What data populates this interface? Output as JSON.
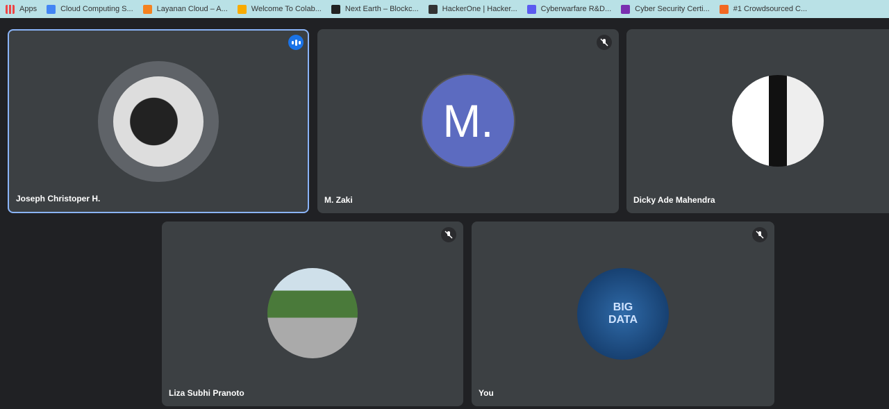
{
  "bookmarks": [
    {
      "label": "Apps",
      "icon": "apps-grid-icon",
      "color": "#e44"
    },
    {
      "label": "Cloud Computing S...",
      "icon": "google-cloud-icon",
      "color": "#4285f4"
    },
    {
      "label": "Layanan Cloud – A...",
      "icon": "aws-cube-icon",
      "color": "#f5821f"
    },
    {
      "label": "Welcome To Colab...",
      "icon": "colab-icon",
      "color": "#f9ab00"
    },
    {
      "label": "Next Earth – Blockc...",
      "icon": "next-earth-icon",
      "color": "#222"
    },
    {
      "label": "HackerOne | Hacker...",
      "icon": "hackerone-icon",
      "color": "#333"
    },
    {
      "label": "Cyberwarfare R&D...",
      "icon": "cyberwarfare-icon",
      "color": "#5b5bf0"
    },
    {
      "label": "Cyber Security Certi...",
      "icon": "shield-icon",
      "color": "#7a2fb0"
    },
    {
      "label": "#1 Crowdsourced C...",
      "icon": "bugcrowd-icon",
      "color": "#f26822"
    }
  ],
  "participants": [
    {
      "name": "Joseph Christoper H.",
      "speaking": true,
      "muted": false
    },
    {
      "name": "M. Zaki",
      "initials": "M.",
      "muted": true,
      "avatar_color": "#5c6bc0"
    },
    {
      "name": "Dicky Ade Mahendra",
      "muted": false
    },
    {
      "name": "Liza Subhi Pranoto",
      "muted": true
    },
    {
      "name": "You",
      "muted": true,
      "avatar_text": "BIG DATA"
    }
  ]
}
